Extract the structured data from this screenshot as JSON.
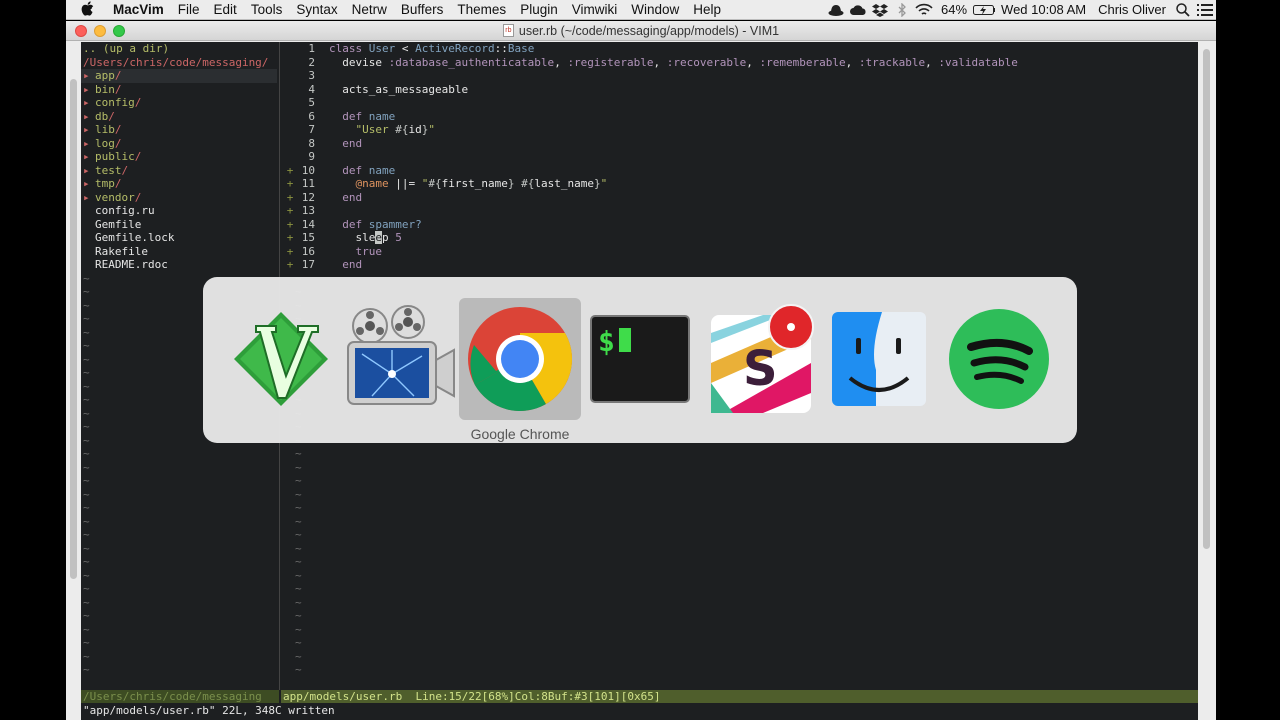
{
  "menubar": {
    "app_name": "MacVim",
    "items": [
      "File",
      "Edit",
      "Tools",
      "Syntax",
      "Netrw",
      "Buffers",
      "Themes",
      "Plugin",
      "Vimwiki",
      "Window",
      "Help"
    ],
    "battery": "64%",
    "clock": "Wed 10:08 AM",
    "user": "Chris Oliver"
  },
  "window": {
    "title": "user.rb (~/code/messaging/app/models) - VIM1",
    "doc_icon_label": "rb"
  },
  "tree": {
    "up": ".. (up a dir)",
    "path": "/Users/chris/code/messaging/",
    "dirs": [
      "app",
      "bin",
      "config",
      "db",
      "lib",
      "log",
      "public",
      "test",
      "tmp",
      "vendor"
    ],
    "files": [
      "config.ru",
      "Gemfile",
      "Gemfile.lock",
      "Rakefile",
      "README.rdoc"
    ],
    "tilde": "~"
  },
  "code": {
    "lines": [
      {
        "n": "1",
        "sign": ""
      },
      {
        "n": "2",
        "sign": ""
      },
      {
        "n": "3",
        "sign": ""
      },
      {
        "n": "4",
        "sign": ""
      },
      {
        "n": "5",
        "sign": ""
      },
      {
        "n": "6",
        "sign": ""
      },
      {
        "n": "7",
        "sign": ""
      },
      {
        "n": "8",
        "sign": ""
      },
      {
        "n": "9",
        "sign": ""
      },
      {
        "n": "10",
        "sign": "+"
      },
      {
        "n": "11",
        "sign": "+"
      },
      {
        "n": "12",
        "sign": "+"
      },
      {
        "n": "13",
        "sign": "+"
      },
      {
        "n": "14",
        "sign": "+"
      },
      {
        "n": "15",
        "sign": "+"
      },
      {
        "n": "16",
        "sign": "+"
      },
      {
        "n": "17",
        "sign": "+"
      }
    ],
    "line1": [
      "class ",
      "User",
      " < ",
      "ActiveRecord",
      "::",
      "Base"
    ],
    "line2": [
      "  devise ",
      ":database_authenticatable",
      ", ",
      ":registerable",
      ", ",
      ":recoverable",
      ", ",
      ":rememberable",
      ", ",
      ":trackable",
      ", ",
      ":validatable"
    ],
    "line4": "  acts_as_messageable",
    "line6": [
      "  def ",
      "name"
    ],
    "line7": [
      "    \"",
      "User ",
      "#{",
      "id",
      "}",
      "\""
    ],
    "line8": "  end",
    "line10": [
      "  def ",
      "name"
    ],
    "line11": [
      "    ",
      "@name",
      " ||= ",
      "\"",
      "#{",
      "first_name",
      "}",
      " ",
      "#{",
      "last_name",
      "}",
      "\""
    ],
    "line12": "  end",
    "line14": [
      "  def ",
      "spammer?"
    ],
    "line15": [
      "    sle",
      "e",
      "p ",
      "5"
    ],
    "line16": "    true",
    "line17": "  end"
  },
  "status": {
    "left": "/Users/chris/code/messaging",
    "right": "app/models/user.rb  Line:15/22[68%]Col:8Buf:#3[101][0x65]"
  },
  "cmdline": "\"app/models/user.rb\" 22L, 348C written",
  "switcher": {
    "selected_app": "Google Chrome",
    "apps": [
      "MacVim",
      "Screenflow",
      "Google Chrome",
      "Terminal",
      "Slack",
      "Finder",
      "Spotify"
    ]
  },
  "colors": {
    "editor_bg": "#1d1f21",
    "keyword": "#b294bb",
    "class": "#81a2be",
    "string": "#b5bd68",
    "status_bg": "#4f5e2c"
  }
}
